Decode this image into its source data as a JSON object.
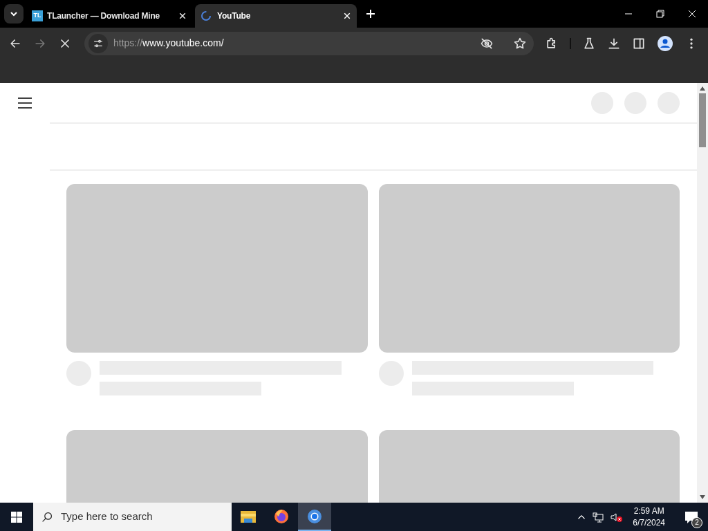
{
  "tabs": [
    {
      "kind": "badge",
      "title": "TLauncher — Download Mine",
      "icon": "TL",
      "selected": false
    },
    {
      "kind": "spinner",
      "title": "YouTube",
      "selected": true
    }
  ],
  "address_bar": {
    "scheme": "https://",
    "host": "www.youtube.com/"
  },
  "taskbar": {
    "search": {
      "placeholder": "Type here to search"
    },
    "apps": [
      {
        "kind": "files",
        "selected": false
      },
      {
        "kind": "firefox",
        "selected": false
      },
      {
        "kind": "chrome",
        "selected": true
      }
    ],
    "clock": {
      "time": "2:59 AM",
      "date": "6/7/2024"
    },
    "notifications": {
      "count": "2"
    }
  }
}
